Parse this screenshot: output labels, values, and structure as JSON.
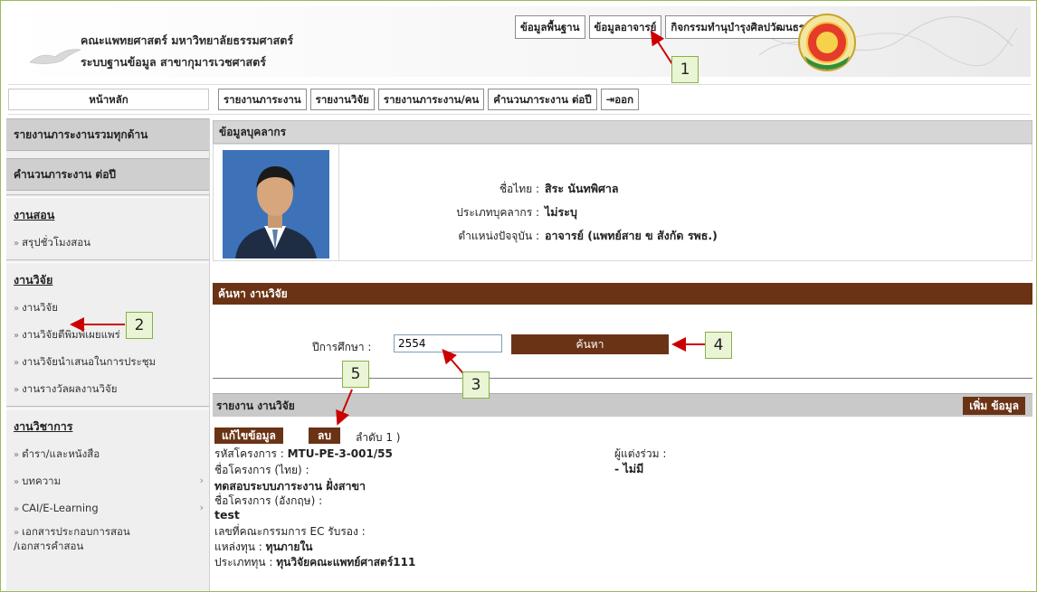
{
  "header": {
    "title1": "คณะแพทยศาสตร์ มหาวิทยาลัยธรรมศาสตร์",
    "title2": "ระบบฐานข้อมูล สาขากุมารเวชศาสตร์",
    "buttons": [
      "ข้อมูลพื้นฐาน",
      "ข้อมูลอาจารย์",
      "กิจกรรมทำนุบำรุงศิลปวัฒนธรรม"
    ]
  },
  "nav": {
    "home": "หน้าหลัก",
    "items": [
      "รายงานภาระงาน",
      "รายงานวิจัย",
      "รายงานภาระงาน/คน",
      "คำนวนภาระงาน ต่อปี"
    ],
    "logout": "ออก"
  },
  "sidebar": {
    "top1": "รายงานภาระงานรวมทุกด้าน",
    "top2": "คำนวนภาระงาน ต่อปี",
    "teaching": {
      "title": "งานสอน",
      "items": [
        "สรุปชั่วโมงสอน"
      ]
    },
    "research": {
      "title": "งานวิจัย",
      "items": [
        "งานวิจัย",
        "งานวิจัยตีพิมพ์เผยแพร่",
        "งานวิจัยนำเสนอในการประชุม",
        "งานรางวัลผลงานวิจัย"
      ]
    },
    "academic": {
      "title": "งานวิชาการ",
      "items": [
        "ตำรา/และหนังสือ",
        "บทความ",
        "CAI/E-Learning",
        "เอกสารประกอบการสอน",
        "/เอกสารคำสอน"
      ]
    }
  },
  "personnel": {
    "section_title": "ข้อมูลบุคลากร",
    "name_label": "ชื่อไทย :",
    "name": "สิระ นันทพิศาล",
    "type_label": "ประเภทบุคลากร :",
    "type": "ไม่ระบุ",
    "position_label": "ตำแหน่งปัจจุบัน :",
    "position": "อาจารย์ (แพทย์สาย ข สังกัด รพธ.)"
  },
  "search": {
    "bar_title": "ค้นหา งานวิจัย",
    "year_label": "ปีการศึกษา :",
    "year_value": "2554",
    "button": "ค้นหา"
  },
  "report": {
    "bar_title": "รายงาน งานวิจัย",
    "add_button": "เพิ่ม ข้อมูล",
    "edit_button": "แก้ไขข้อมูล",
    "delete_button": "ลบ",
    "order": "ลำดับ 1 )",
    "project_code_label": "รหัสโครงการ :",
    "project_code": "MTU-PE-3-001/55",
    "name_th_label": "ชื่อโครงการ (ไทย) :",
    "name_th": "ทดสอบระบบภาระงาน ฝั่งสาขา",
    "name_en_label": "ชื่อโครงการ (อังกฤษ) :",
    "name_en": "test",
    "ec_label": "เลขที่คณะกรรมการ EC รับรอง :",
    "fund_source_label": "แหล่งทุน :",
    "fund_source": "ทุนภายใน",
    "fund_type_label": "ประเภททุน :",
    "fund_type": "ทุนวิจัยคณะแพทย์ศาสตร์111",
    "coauthor_label": "ผู้แต่งร่วม :",
    "coauthor": "- ไม่มี"
  },
  "annotations": [
    "1",
    "2",
    "3",
    "4",
    "5"
  ],
  "colors": {
    "accent_brown": "#6b3315",
    "annotation_fill": "#e9f5d4",
    "arrow_red": "#cc0000"
  }
}
